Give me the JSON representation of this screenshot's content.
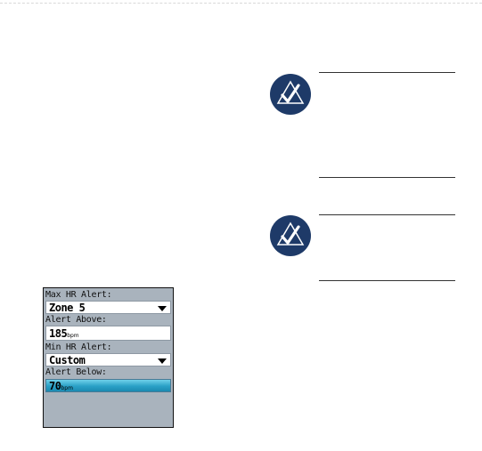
{
  "device": {
    "max_hr_label": "Max HR Alert:",
    "max_hr_value": "Zone 5",
    "alert_above_label": "Alert Above:",
    "alert_above_value": "185",
    "alert_above_unit": "bpm",
    "min_hr_label": "Min HR Alert:",
    "min_hr_value": "Custom",
    "alert_below_label": "Alert Below:",
    "alert_below_value": "70",
    "alert_below_unit": "bpm"
  },
  "notes": [
    {
      "icon": "note-check-icon"
    },
    {
      "icon": "note-check-icon"
    }
  ],
  "colors": {
    "note_icon": "#1e3a68",
    "device_bg": "#a9b3bd",
    "highlight": "#2aa0c6"
  }
}
